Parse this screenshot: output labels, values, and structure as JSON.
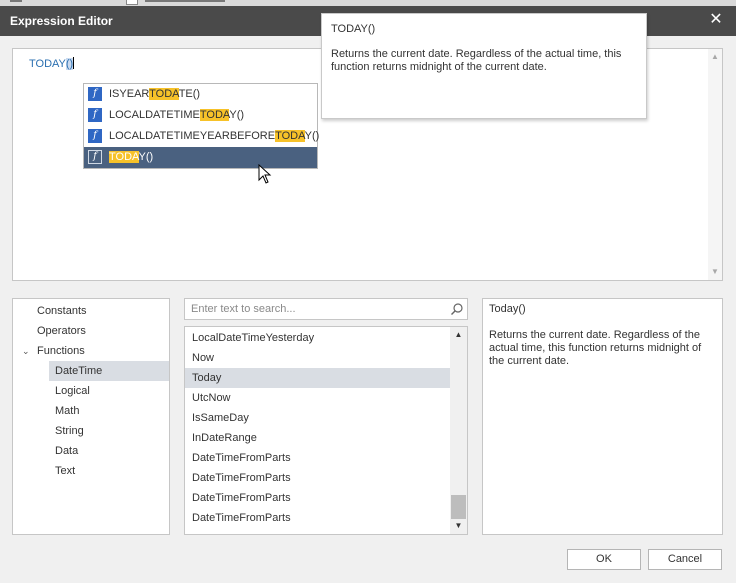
{
  "window": {
    "title": "Expression Editor",
    "close_glyph": "✕"
  },
  "editor": {
    "expression_prefix": "TODAY",
    "expression_parens": "()",
    "scroll_up": "▲",
    "scroll_down": "▼"
  },
  "autocomplete": {
    "items": [
      {
        "pre": "ISYEAR",
        "hl": "TODA",
        "post": "TE()"
      },
      {
        "pre": "LOCALDATETIME",
        "hl": "TODA",
        "post": "Y()"
      },
      {
        "pre": "LOCALDATETIMEYEARBEFORE",
        "hl": "TODA",
        "post": "Y()"
      },
      {
        "pre": "",
        "hl": "TODA",
        "post": "Y()"
      }
    ],
    "selected_index": 3,
    "icon": "function-icon",
    "icon_glyph": "f"
  },
  "tooltip": {
    "title": "TODAY()",
    "description": "Returns the current date. Regardless of the actual time, this function returns midnight of the current date."
  },
  "categories": {
    "items": [
      "Constants",
      "Operators",
      "Functions",
      "DateTime",
      "Logical",
      "Math",
      "String",
      "Data",
      "Text"
    ],
    "selected": "DateTime",
    "expand_arrow": "⌄"
  },
  "search": {
    "placeholder": "Enter text to search..."
  },
  "functions": {
    "items": [
      "LocalDateTimeYesterday",
      "Now",
      "Today",
      "UtcNow",
      "IsSameDay",
      "InDateRange",
      "DateTimeFromParts",
      "DateTimeFromParts",
      "DateTimeFromParts",
      "DateTimeFromParts"
    ],
    "selected": "Today",
    "scroll_up": "▲",
    "scroll_down": "▼"
  },
  "description_panel": {
    "title": "Today()",
    "text": "Returns the current date. Regardless of the actual time, this function returns midnight of the current date."
  },
  "buttons": {
    "ok": "OK",
    "cancel": "Cancel"
  },
  "colors": {
    "titlebar": "#4a4a4a",
    "selection": "#4a6180",
    "highlight": "#f7c229",
    "function_icon": "#2f67c4",
    "expression_text": "#2a6fb0"
  }
}
